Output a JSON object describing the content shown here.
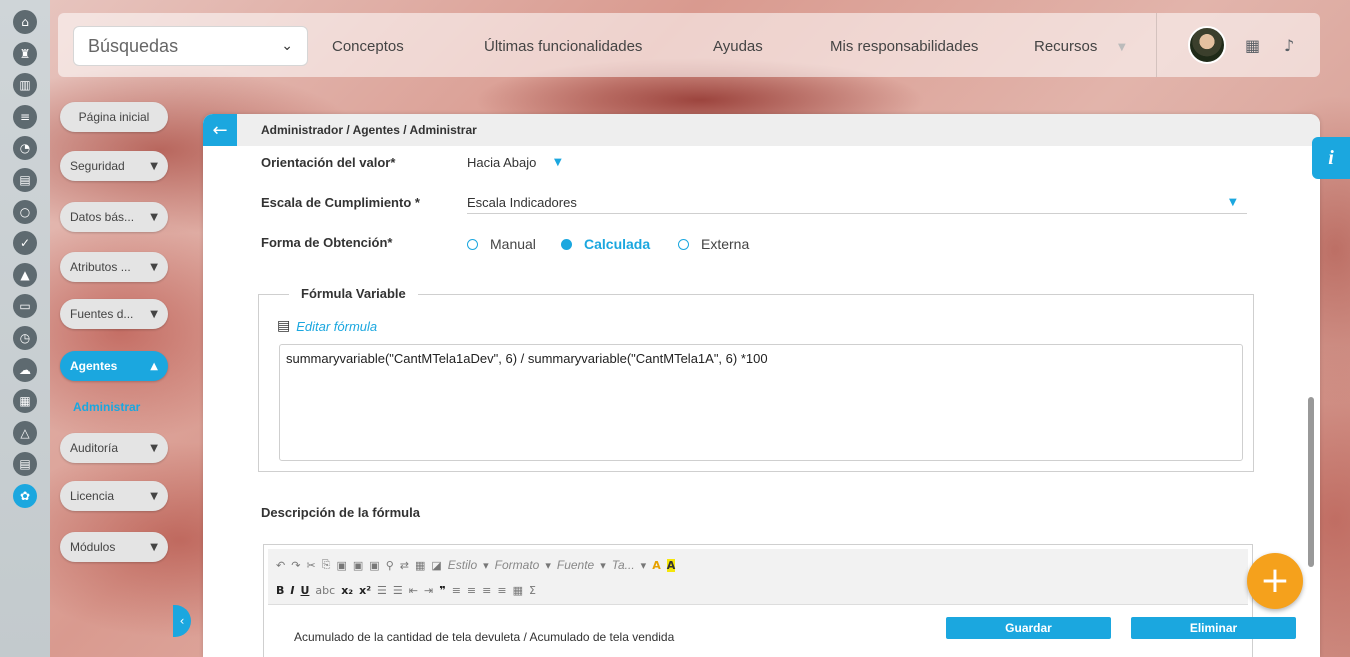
{
  "rail_icons": [
    {
      "name": "home-icon",
      "glyph": "⌂"
    },
    {
      "name": "chess-rook-icon",
      "glyph": "♜"
    },
    {
      "name": "bar-chart-icon",
      "glyph": "▥"
    },
    {
      "name": "align-icon",
      "glyph": "≡"
    },
    {
      "name": "pie-chart-icon",
      "glyph": "◔"
    },
    {
      "name": "document-icon",
      "glyph": "▤"
    },
    {
      "name": "circle-refresh-icon",
      "glyph": "○"
    },
    {
      "name": "check-icon",
      "glyph": "✓"
    },
    {
      "name": "warning-icon",
      "glyph": "▲"
    },
    {
      "name": "presentation-icon",
      "glyph": "▭"
    },
    {
      "name": "clock-icon",
      "glyph": "◷"
    },
    {
      "name": "cloud-icon",
      "glyph": "☁"
    },
    {
      "name": "calendar-icon",
      "glyph": "▦"
    },
    {
      "name": "network-icon",
      "glyph": "△"
    },
    {
      "name": "list-doc-icon",
      "glyph": "▤"
    },
    {
      "name": "settings-icon",
      "glyph": "✿"
    }
  ],
  "topbar": {
    "search_label": "Búsquedas",
    "nav": [
      "Conceptos",
      "Últimas funcionalidades",
      "Ayudas",
      "Mis responsabilidades",
      "Recursos"
    ]
  },
  "sidebar": {
    "home": "Página inicial",
    "items": [
      "Seguridad",
      "Datos bás...",
      "Atributos ...",
      "Fuentes d...",
      "Agentes",
      "Auditoría",
      "Licencia",
      "Módulos"
    ],
    "submenu": "Administrar"
  },
  "panel": {
    "breadcrumb": "Administrador / Agentes / Administrar",
    "orientation_label": "Orientación del valor*",
    "orientation_value": "Hacia Abajo",
    "scale_label": "Escala de Cumplimiento *",
    "scale_value": "Escala Indicadores",
    "obtain_label": "Forma de Obtención*",
    "obtain_options": [
      "Manual",
      "Calculada",
      "Externa"
    ],
    "obtain_selected": "Calculada",
    "formula_legend": "Fórmula Variable",
    "edit_formula": "Editar fórmula",
    "formula": "summaryvariable(\"CantMTela1aDev\", 6)  /  summaryvariable(\"CantMTela1A\", 6)  *100",
    "description_label": "Descripción de la fórmula",
    "toolbar_combos": [
      "Estilo",
      "Formato",
      "Fuente",
      "Ta..."
    ],
    "description_text": "Acumulado de la cantidad de tela devuleta / Acumulado de tela vendida",
    "save_label": "Guardar",
    "delete_label": "Eliminar"
  },
  "info_label": "i",
  "fab_label": "+",
  "colors": {
    "accent": "#1ba7df",
    "fab": "#f5a11c"
  }
}
